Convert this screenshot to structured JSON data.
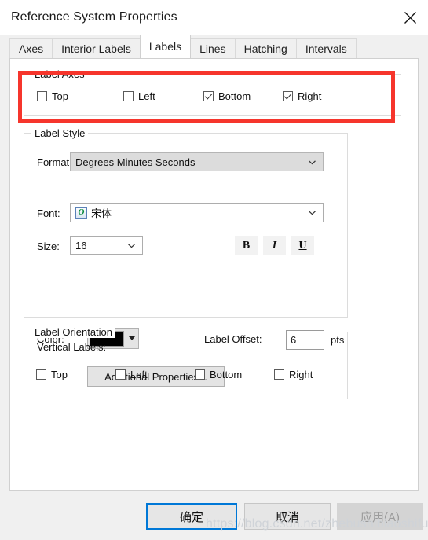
{
  "window": {
    "title": "Reference System Properties",
    "close_icon": "close-icon"
  },
  "tabs": [
    {
      "label": "Axes",
      "selected": false
    },
    {
      "label": "Interior Labels",
      "selected": false
    },
    {
      "label": "Labels",
      "selected": true
    },
    {
      "label": "Lines",
      "selected": false
    },
    {
      "label": "Hatching",
      "selected": false
    },
    {
      "label": "Intervals",
      "selected": false
    }
  ],
  "label_axes": {
    "title": "Label Axes",
    "highlight_color": "#f6352c",
    "checkboxes": [
      {
        "label": "Top",
        "checked": false
      },
      {
        "label": "Left",
        "checked": false
      },
      {
        "label": "Bottom",
        "checked": true
      },
      {
        "label": "Right",
        "checked": true
      }
    ]
  },
  "label_style": {
    "title": "Label Style",
    "format_label": "Format:",
    "format_value": "Degrees Minutes Seconds",
    "font_label": "Font:",
    "font_value": "宋体",
    "font_icon": "opentype-font-icon",
    "font_icon_glyph": "O",
    "size_label": "Size:",
    "size_value": "16",
    "bold_label": "B",
    "italic_label": "I",
    "underline_label": "U",
    "color_label": "Color:",
    "color_value": "#000000",
    "label_offset_label": "Label Offset:",
    "label_offset_value": "6",
    "label_offset_units": "pts",
    "additional_properties_label": "Additional Properties..."
  },
  "label_orientation": {
    "title": "Label Orientation",
    "vertical_labels_label": "Vertical Labels:",
    "checkboxes": [
      {
        "label": "Top",
        "checked": false
      },
      {
        "label": "Left",
        "checked": false
      },
      {
        "label": "Bottom",
        "checked": false
      },
      {
        "label": "Right",
        "checked": false
      }
    ]
  },
  "footer": {
    "ok_label": "确定",
    "cancel_label": "取消",
    "apply_label": "应用(A)"
  },
  "watermark": "https://blog.csdn.net/zhebushibiaoshifu"
}
